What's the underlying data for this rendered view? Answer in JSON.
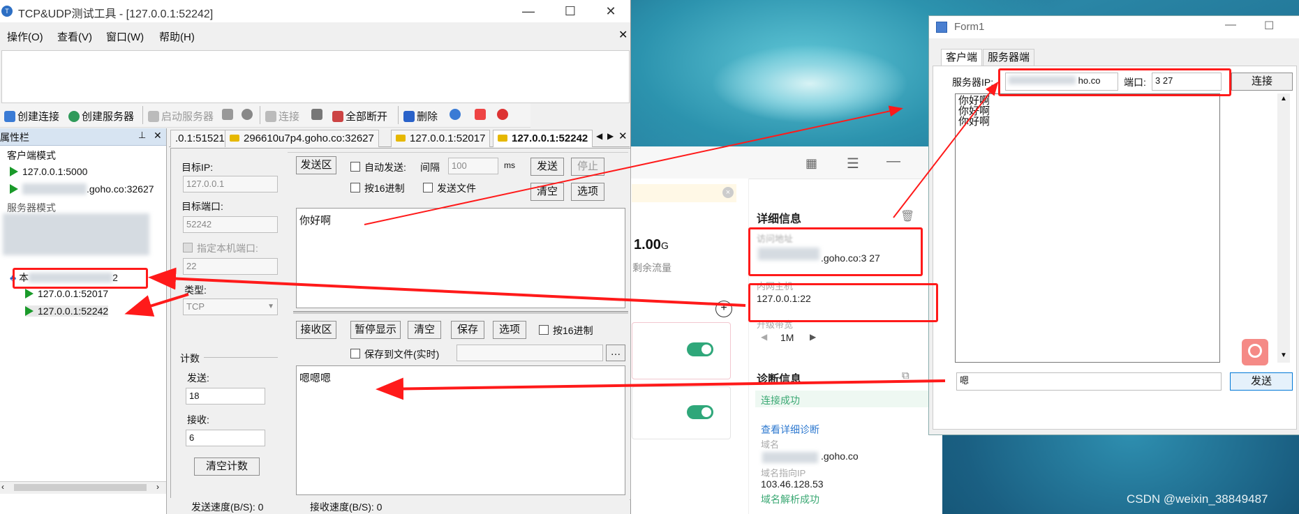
{
  "desktop": {
    "watermark": "CSDN @weixin_38849487"
  },
  "tcp_tool": {
    "title": "TCP&UDP测试工具 - [127.0.0.1:52242]",
    "menu": [
      "操作(O)",
      "查看(V)",
      "窗口(W)",
      "帮助(H)"
    ],
    "toolbar": [
      "创建连接",
      "创建服务器",
      "启动服务器",
      "连接",
      "全部断开",
      "删除"
    ],
    "sidebar": {
      "title": "属性栏",
      "client_mode": "客户端模式",
      "client_items": [
        "127.0.0.1:5000",
        ".goho.co:32627"
      ],
      "server_mode": "服务器模式",
      "local_node": "本",
      "local_node_suffix": "2",
      "server_items": [
        "127.0.0.1:52017",
        "127.0.0.1:52242"
      ]
    },
    "tabs": [
      ".0.1:51521",
      "296610u7p4.goho.co:32627",
      "127.0.0.1:52017",
      "127.0.0.1:52242"
    ],
    "form": {
      "target_ip_label": "目标IP:",
      "target_ip": "127.0.0.1",
      "target_port_label": "目标端口:",
      "target_port": "52242",
      "local_port_label": "指定本机端口:",
      "local_port": "22",
      "type_label": "类型:",
      "type_value": "TCP",
      "count_label": "计数",
      "send_label": "发送:",
      "send_count": "18",
      "recv_label": "接收:",
      "recv_count": "6",
      "clear_count": "清空计数"
    },
    "send_area": {
      "title": "发送区",
      "auto_send": "自动发送:",
      "interval_label": "间隔",
      "interval": "100",
      "ms": "ms",
      "send": "发送",
      "stop": "停止",
      "hex": "按16进制",
      "send_file": "发送文件",
      "clear": "清空",
      "options": "选项",
      "content": "你好啊"
    },
    "recv_area": {
      "title": "接收区",
      "pause": "暂停显示",
      "clear": "清空",
      "save": "保存",
      "options": "选项",
      "hex": "按16进制",
      "save_file": "保存到文件(实时)",
      "content": "嗯嗯嗯"
    },
    "status": {
      "send_speed": "发送速度(B/S): 0",
      "recv_speed": "接收速度(B/S): 0"
    }
  },
  "middle_app": {
    "traffic_value": "1.00",
    "traffic_unit": "G",
    "traffic_label": "剩余流量",
    "detail_title": "详细信息",
    "internet_addr_label": "访问地址",
    "internet_addr": ".goho.co:3  27",
    "lan_host_label": "内网主机",
    "lan_host": "127.0.0.1:22",
    "bandwidth_label": "升级带宽",
    "bandwidth": "1M",
    "diag_title": "诊断信息",
    "diag_status": "连接成功",
    "diag_link": "查看详细诊断",
    "domain_label": "域名",
    "domain": ".goho.co",
    "domain_ip_label": "域名指向IP",
    "domain_ip": "103.46.128.53",
    "domain_status": "域名解析成功"
  },
  "form1": {
    "title": "Form1",
    "tabs": [
      "客户端",
      "服务器端"
    ],
    "server_ip_label": "服务器IP:",
    "server_ip": "ho.co",
    "port_label": "端口:",
    "port": "3  27",
    "connect": "连接",
    "received": [
      "你好啊",
      "你好啊",
      "你好啊"
    ],
    "input": "嗯",
    "send": "发送"
  }
}
